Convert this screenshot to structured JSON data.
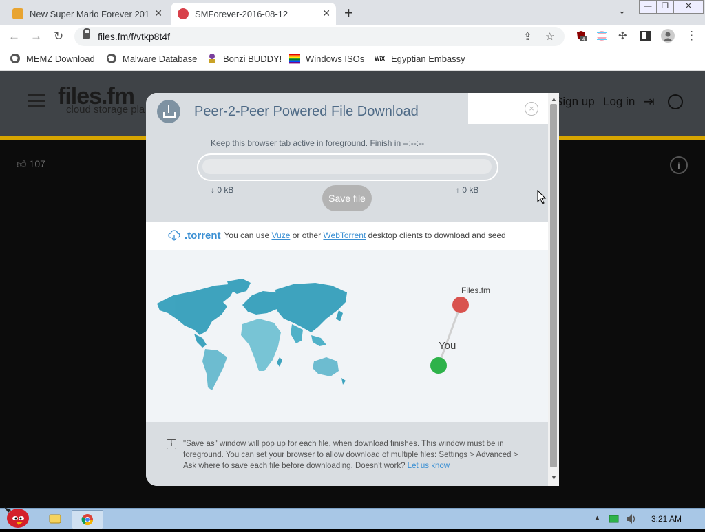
{
  "browser": {
    "tabs": [
      {
        "title": "New Super Mario Forever 201",
        "active": false
      },
      {
        "title": "SMForever-2016-08-12",
        "active": true
      }
    ],
    "new_tab_icon": "plus-icon",
    "window_controls": [
      "minimize-icon",
      "restore-icon",
      "close-icon"
    ],
    "url": "files.fm/f/vtkp8t4f",
    "extension_badge": "4",
    "bookmarks": [
      {
        "label": "MEMZ Download",
        "icon": "globe-icon"
      },
      {
        "label": "Malware Database",
        "icon": "globe-icon"
      },
      {
        "label": "Bonzi BUDDY!",
        "icon": "bonzi-icon"
      },
      {
        "label": "Windows ISOs",
        "icon": "rainbow-flag-icon"
      },
      {
        "label": "Egyptian Embassy",
        "icon": "wix-icon"
      }
    ]
  },
  "site": {
    "logo": "files.fm",
    "logo_sub": "cloud storage pla",
    "signup": "Sign up",
    "login": "Log in",
    "likes": "107"
  },
  "modal": {
    "title": "Peer-2-Peer Powered File Download",
    "close_glyph": "×",
    "keep_text": "Keep this browser tab active in foreground. Finish in --:--:--",
    "progress": 0.0,
    "download_stat": "↓ 0 kB",
    "upload_stat": "↑ 0 kB",
    "save_button": "Save file",
    "torrent": {
      "label": ".torrent",
      "text1": "You can use",
      "link1": "Vuze",
      "text2": "or other",
      "link2": "WebTorrent",
      "text3": "desktop clients to download and seed"
    },
    "map": {
      "node_server_label": "Files.fm",
      "node_you_label": "You",
      "colors": {
        "server": "#d9534f",
        "you": "#2eb24a",
        "land": "#2b9bb8"
      }
    },
    "note": {
      "text": "\"Save as\" window will pop up for each file, when download finishes. This window must be in foreground. You can set your browser to allow download of multiple files: Settings > Advanced > Ask where to save each file before downloading. Doesn't work?",
      "link": "Let us know"
    }
  },
  "taskbar": {
    "time": "3:21 AM"
  }
}
